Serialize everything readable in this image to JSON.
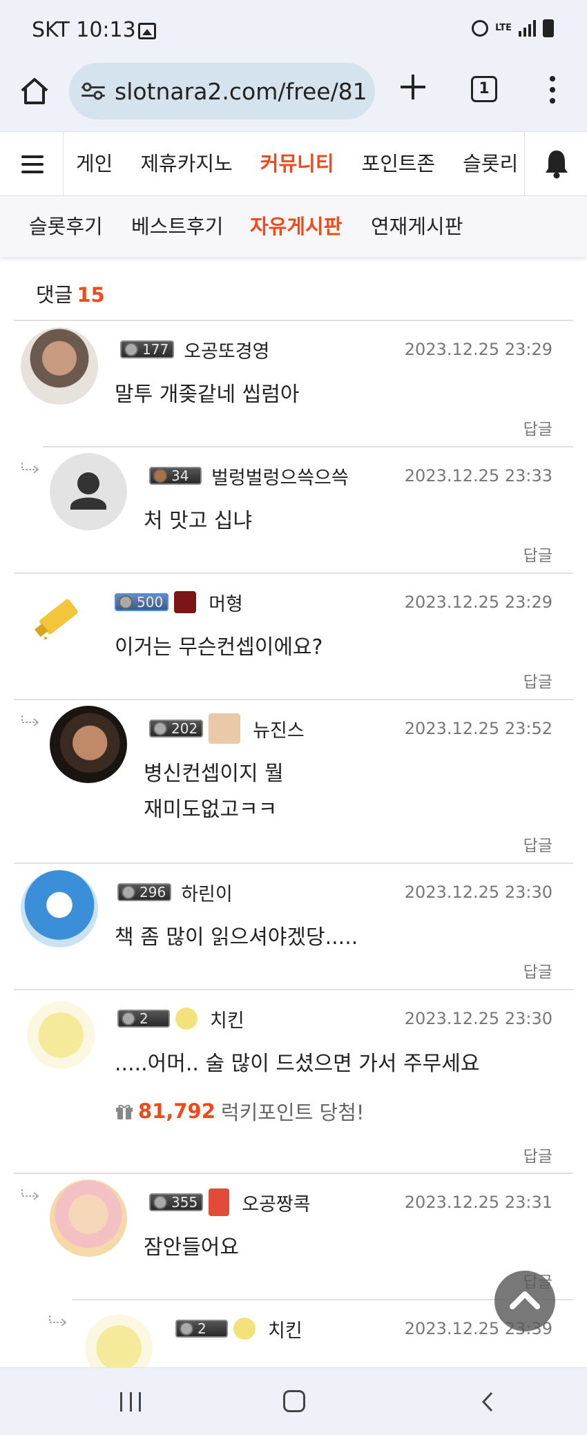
{
  "status_bar": {
    "time": "SKT 10:13",
    "network": "LTE",
    "icons": [
      "image-icon",
      "alarm-icon",
      "lte-icon",
      "signal-icon",
      "battery-icon"
    ]
  },
  "browser": {
    "url": "slotnara2.com/free/81",
    "tab_count": "1",
    "icons": [
      "home-icon",
      "site-settings-icon",
      "new-tab-icon",
      "tabs-icon",
      "menu-icon"
    ]
  },
  "site_nav": {
    "items": [
      "게인",
      "제휴카지노",
      "커뮤니티",
      "포인트존",
      "슬롯리"
    ],
    "active_index": 2
  },
  "sub_nav": {
    "items": [
      "슬롯후기",
      "베스트후기",
      "자유게시판",
      "연재게시판"
    ],
    "active_index": 2
  },
  "comments_section": {
    "label": "댓글",
    "count": "15",
    "reply_label": "답글"
  },
  "comments": [
    {
      "level": "177",
      "nick": "오공또경영",
      "date": "2023.12.25 23:29",
      "lines": [
        "말투 개좆같네 씹럼아"
      ]
    },
    {
      "level": "34",
      "nick": "벌렁벌렁으쓱으쓱",
      "date": "2023.12.25 23:33",
      "lines": [
        "처 맛고 십냐"
      ]
    },
    {
      "level": "500",
      "nick": "머형",
      "date": "2023.12.25 23:29",
      "lines": [
        "이거는 무슨컨셉이에요?"
      ]
    },
    {
      "level": "202",
      "nick": "뉴진스",
      "date": "2023.12.25 23:52",
      "lines": [
        "병신컨셉이지 뭘",
        "재미도없고ㅋㅋ"
      ]
    },
    {
      "level": "296",
      "nick": "하린이",
      "date": "2023.12.25 23:30",
      "lines": [
        "책 좀 많이 읽으셔야겠당....."
      ]
    },
    {
      "level": "2",
      "nick": "치킨",
      "date": "2023.12.25 23:30",
      "lines": [
        ".....어머..  술 많이 드셨으면 가서 주무세요"
      ],
      "lucky_points": "81,792",
      "lucky_text": "럭키포인트 당첨!"
    },
    {
      "level": "355",
      "nick": "오공짱콕",
      "date": "2023.12.25 23:31",
      "lines": [
        "잠안들어요"
      ]
    },
    {
      "level": "2",
      "nick": "치킨",
      "date": "2023.12.25 23:39",
      "lines": []
    }
  ],
  "colors": {
    "accent": "#ee4a1c",
    "status_bg": "#eef1f8",
    "url_pill": "#d5e3ef",
    "meta_text": "#777777"
  }
}
